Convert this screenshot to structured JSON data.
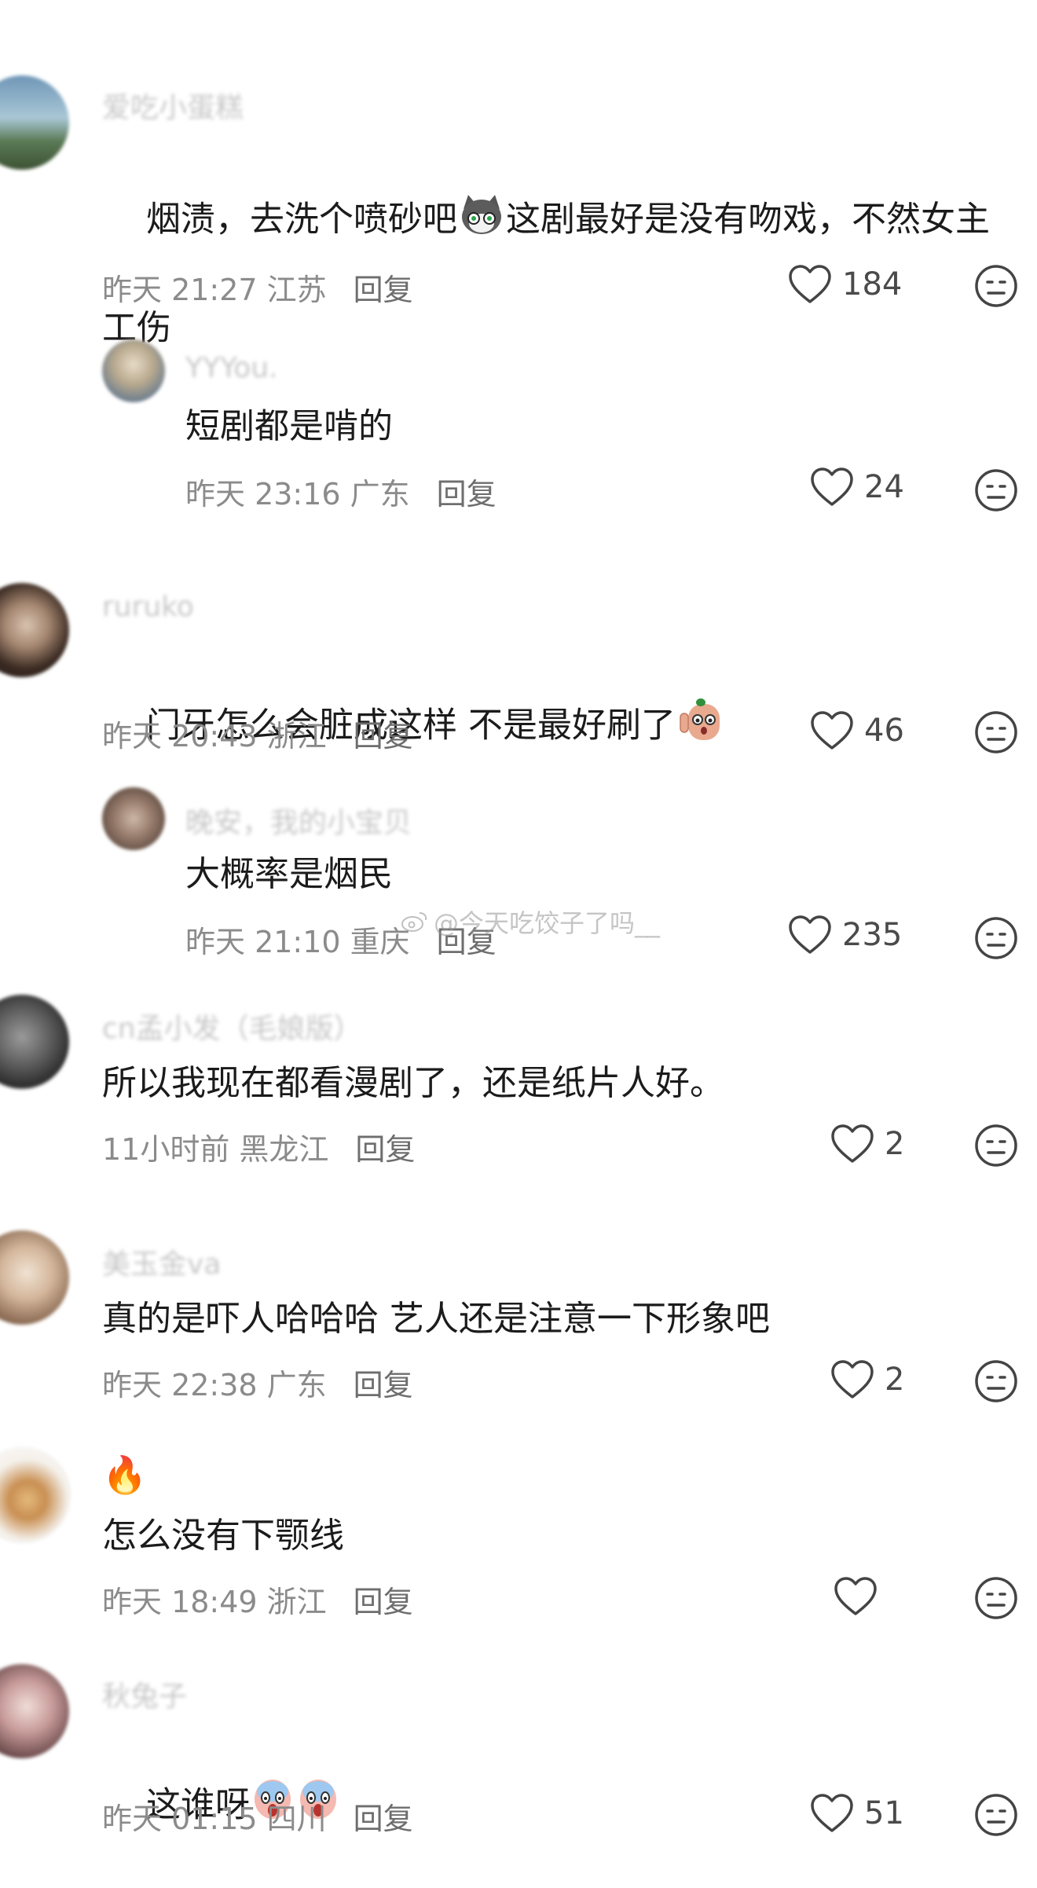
{
  "comments": [
    {
      "username": "爱吃小蛋糕",
      "text_a": "烟渍，去洗个喷砂吧",
      "text_b": "这剧最好是没有吻戏，不然女主",
      "text_c": "工伤",
      "emoji": "cat-face-icon",
      "time": "昨天 21:27",
      "location": "江苏",
      "reply": "回复",
      "likes": "184"
    },
    {
      "username": "YYYou.",
      "text": "短剧都是啃的",
      "time": "昨天 23:16",
      "location": "广东",
      "reply": "回复",
      "likes": "24"
    },
    {
      "username": "ruruko",
      "text": "门牙怎么会脏成这样 不是最好刷了",
      "emoji": "shocked-sausage-icon",
      "time": "昨天 20:43",
      "location": "浙江",
      "reply": "回复",
      "likes": "46"
    },
    {
      "username": "晚安，我的小宝贝",
      "text": "大概率是烟民",
      "time": "昨天 21:10",
      "location": "重庆",
      "reply": "回复",
      "likes": "235"
    },
    {
      "username": "cn孟小发（毛娘版）",
      "text": "所以我现在都看漫剧了，还是纸片人好。",
      "time": "11小时前",
      "location": "黑龙江",
      "reply": "回复",
      "likes": "2"
    },
    {
      "username": "美玉金va",
      "text": "真的是吓人哈哈哈 艺人还是注意一下形象吧",
      "time": "昨天 22:38",
      "location": "广东",
      "reply": "回复",
      "likes": "2"
    },
    {
      "username": "🔥",
      "text": "怎么没有下颚线",
      "time": "昨天 18:49",
      "location": "浙江",
      "reply": "回复",
      "likes": ""
    },
    {
      "username": "秋兔子",
      "text": "这谁呀",
      "emoji": "screaming-face-icon",
      "time": "昨天 01:15",
      "location": "四川",
      "reply": "回复",
      "likes": "51"
    }
  ],
  "watermark": "@今天吃饺子了吗__",
  "colors": {
    "text": "#1b1b1b",
    "meta": "#8b8b8b",
    "username": "#c7c7c7"
  }
}
